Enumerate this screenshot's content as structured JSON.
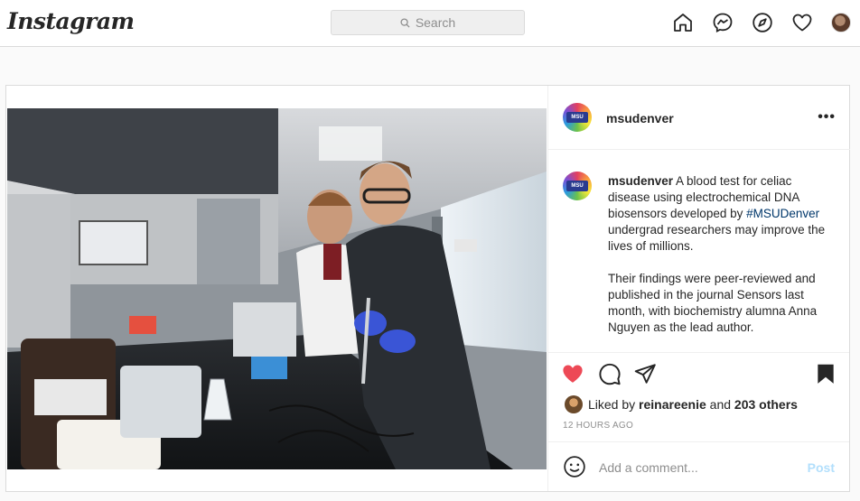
{
  "nav": {
    "logo": "Instagram",
    "search_placeholder": "Search",
    "icons": [
      "home-icon",
      "messenger-icon",
      "explore-icon",
      "activity-heart-icon",
      "profile-avatar"
    ]
  },
  "post": {
    "username": "msudenver",
    "avatar_text": "MSU",
    "caption_user": "msudenver",
    "caption_part1": " A blood test for celiac disease using electrochemical DNA biosensors developed by ",
    "hashtag": "#MSUDenver",
    "caption_part2": " undergrad researchers may improve the lives of millions.",
    "caption_para2": "Their findings were peer-reviewed and published in the journal Sensors last month, with biochemistry alumna Anna Nguyen as the lead author.",
    "liked_prefix": "Liked by ",
    "liked_user": "reinareenie",
    "liked_and": " and ",
    "liked_others": "203 others",
    "timestamp": "12 HOURS AGO",
    "comment_placeholder": "Add a comment...",
    "post_button": "Post",
    "more_label": "•••"
  },
  "colors": {
    "like_red": "#ed4956",
    "post_disabled": "#b2dffc",
    "hashtag_blue": "#00376b"
  }
}
